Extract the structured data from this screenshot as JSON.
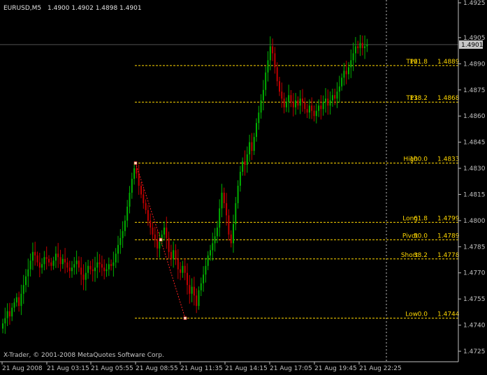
{
  "header": {
    "symbol": "EURUSD,M5",
    "ohlc": "1.4900 1.4902 1.4898 1.4901"
  },
  "footer": {
    "copyright": "X-Trader, © 2001-2008 MetaQuotes Software Corp."
  },
  "colors": {
    "background": "#000000",
    "bull_candle": "#00b000",
    "bear_candle": "#c00000",
    "fib_line": "#ffd700",
    "zigzag": "#ff2020",
    "axis_text": "#c0c0c0",
    "price_tag_bg": "#c8c8c8"
  },
  "chart_data": {
    "type": "candlestick",
    "y_axis": {
      "min": 1.4725,
      "max": 1.4925,
      "ticks": [
        "1.4925",
        "1.4905",
        "1.4890",
        "1.4875",
        "1.4860",
        "1.4845",
        "1.4830",
        "1.4815",
        "1.4800",
        "1.4785",
        "1.4770",
        "1.4755",
        "1.4740",
        "1.4725"
      ]
    },
    "current_price": "1.4901",
    "x_ticks": [
      "21 Aug 2008",
      "21 Aug 03:15",
      "21 Aug 05:55",
      "21 Aug 08:55",
      "21 Aug 11:35",
      "21 Aug 14:15",
      "21 Aug 17:05",
      "21 Aug 19:45",
      "21 Aug 22:25"
    ],
    "fib_levels": [
      {
        "label": "TP2",
        "ratio": "161.8",
        "price": "1.4889"
      },
      {
        "label": "TP1",
        "ratio": "138.2",
        "price": "1.4868"
      },
      {
        "label": "High",
        "ratio": "100.0",
        "price": "1.4833"
      },
      {
        "label": "Long",
        "ratio": "61.8",
        "price": "1.4799"
      },
      {
        "label": "Pivot",
        "ratio": "50.0",
        "price": "1.4789"
      },
      {
        "label": "Short",
        "ratio": "38.2",
        "price": "1.4778"
      },
      {
        "label": "Low",
        "ratio": "0.0",
        "price": "1.4744"
      }
    ],
    "zigzag": [
      1.4833,
      1.4789,
      1.4744
    ],
    "closes": [
      1.4741,
      1.4744,
      1.4748,
      1.4745,
      1.475,
      1.4753,
      1.4756,
      1.4751,
      1.4758,
      1.4763,
      1.4768,
      1.4772,
      1.4777,
      1.4782,
      1.478,
      1.4776,
      1.4773,
      1.4775,
      1.4779,
      1.4778,
      1.4776,
      1.4774,
      1.4777,
      1.4781,
      1.4779,
      1.4775,
      1.4778,
      1.4776,
      1.4773,
      1.4771,
      1.4773,
      1.4775,
      1.4777,
      1.4773,
      1.4769,
      1.4766,
      1.477,
      1.4774,
      1.4772,
      1.4771,
      1.4773,
      1.4776,
      1.4775,
      1.4773,
      1.4771,
      1.4772,
      1.4775,
      1.4774,
      1.4776,
      1.4781,
      1.4786,
      1.479,
      1.4794,
      1.48,
      1.4808,
      1.4816,
      1.4824,
      1.483,
      1.4827,
      1.482,
      1.4815,
      1.481,
      1.4806,
      1.48,
      1.4796,
      1.4792,
      1.4789,
      1.4784,
      1.4788,
      1.4792,
      1.4796,
      1.479,
      1.4782,
      1.4778,
      1.4783,
      1.4778,
      1.4772,
      1.477,
      1.4774,
      1.477,
      1.4763,
      1.4758,
      1.4762,
      1.4757,
      1.4751,
      1.476,
      1.4764,
      1.4769,
      1.4774,
      1.478,
      1.4783,
      1.4787,
      1.4791,
      1.4796,
      1.4807,
      1.4816,
      1.481,
      1.4803,
      1.4792,
      1.4787,
      1.4798,
      1.481,
      1.482,
      1.4828,
      1.4834,
      1.4832,
      1.4838,
      1.4845,
      1.484,
      1.4848,
      1.4856,
      1.4862,
      1.4869,
      1.4875,
      1.4885,
      1.4892,
      1.49,
      1.4896,
      1.4888,
      1.488,
      1.4874,
      1.487,
      1.4865,
      1.4868,
      1.4872,
      1.4868,
      1.4865,
      1.4869,
      1.4866,
      1.487,
      1.4868,
      1.4864,
      1.4862,
      1.4866,
      1.4863,
      1.486,
      1.4863,
      1.4866,
      1.4864,
      1.4868,
      1.487,
      1.4866,
      1.4869,
      1.4872,
      1.487,
      1.4874,
      1.4877,
      1.4882,
      1.4886,
      1.4884,
      1.4888,
      1.4892,
      1.4896,
      1.49,
      1.4899,
      1.4902,
      1.4899,
      1.49,
      1.4901
    ]
  }
}
